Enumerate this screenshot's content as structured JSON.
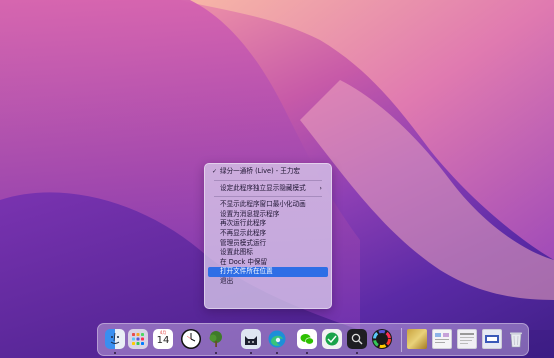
{
  "context_menu": {
    "items": [
      {
        "label": "绿分一通桥 (Live) - 王力宏",
        "checked": true
      },
      {
        "label": "设定此程序独立显示隐藏模式",
        "submenu": true
      },
      {
        "label": "不显示此程序窗口最小化动画"
      },
      {
        "label": "设置为消息提示程序"
      },
      {
        "label": "再次运行此程序"
      },
      {
        "label": "不再显示此程序"
      },
      {
        "label": "管理员模式运行"
      },
      {
        "label": "设置此图标"
      },
      {
        "label": "在 Dock 中保留"
      },
      {
        "label": "打开文件所在位置",
        "selected": true
      },
      {
        "label": "退出"
      }
    ],
    "check_glyph": "✓",
    "submenu_glyph": "›"
  },
  "dock": {
    "calendar": {
      "month": "4月",
      "day": "14"
    },
    "apps": [
      {
        "name": "finder-icon"
      },
      {
        "name": "launchpad-icon"
      },
      {
        "name": "calendar-icon"
      },
      {
        "name": "clock-icon"
      },
      {
        "name": "music-app-icon"
      },
      {
        "name": "cat-app-icon"
      },
      {
        "name": "edge-browser-icon"
      },
      {
        "name": "wechat-icon"
      },
      {
        "name": "green-app-icon"
      },
      {
        "name": "search-app-icon"
      },
      {
        "name": "color-wheel-icon"
      },
      {
        "name": "golden-image-thumbnail"
      },
      {
        "name": "screenshot-thumbnail-1"
      },
      {
        "name": "screenshot-thumbnail-2"
      },
      {
        "name": "screenshot-thumbnail-3"
      },
      {
        "name": "trash-icon"
      }
    ]
  },
  "colors": {
    "selection": "#2e6ee6",
    "wallpaper_pink": "#e88aa8",
    "wallpaper_purple": "#5b2aa6"
  }
}
